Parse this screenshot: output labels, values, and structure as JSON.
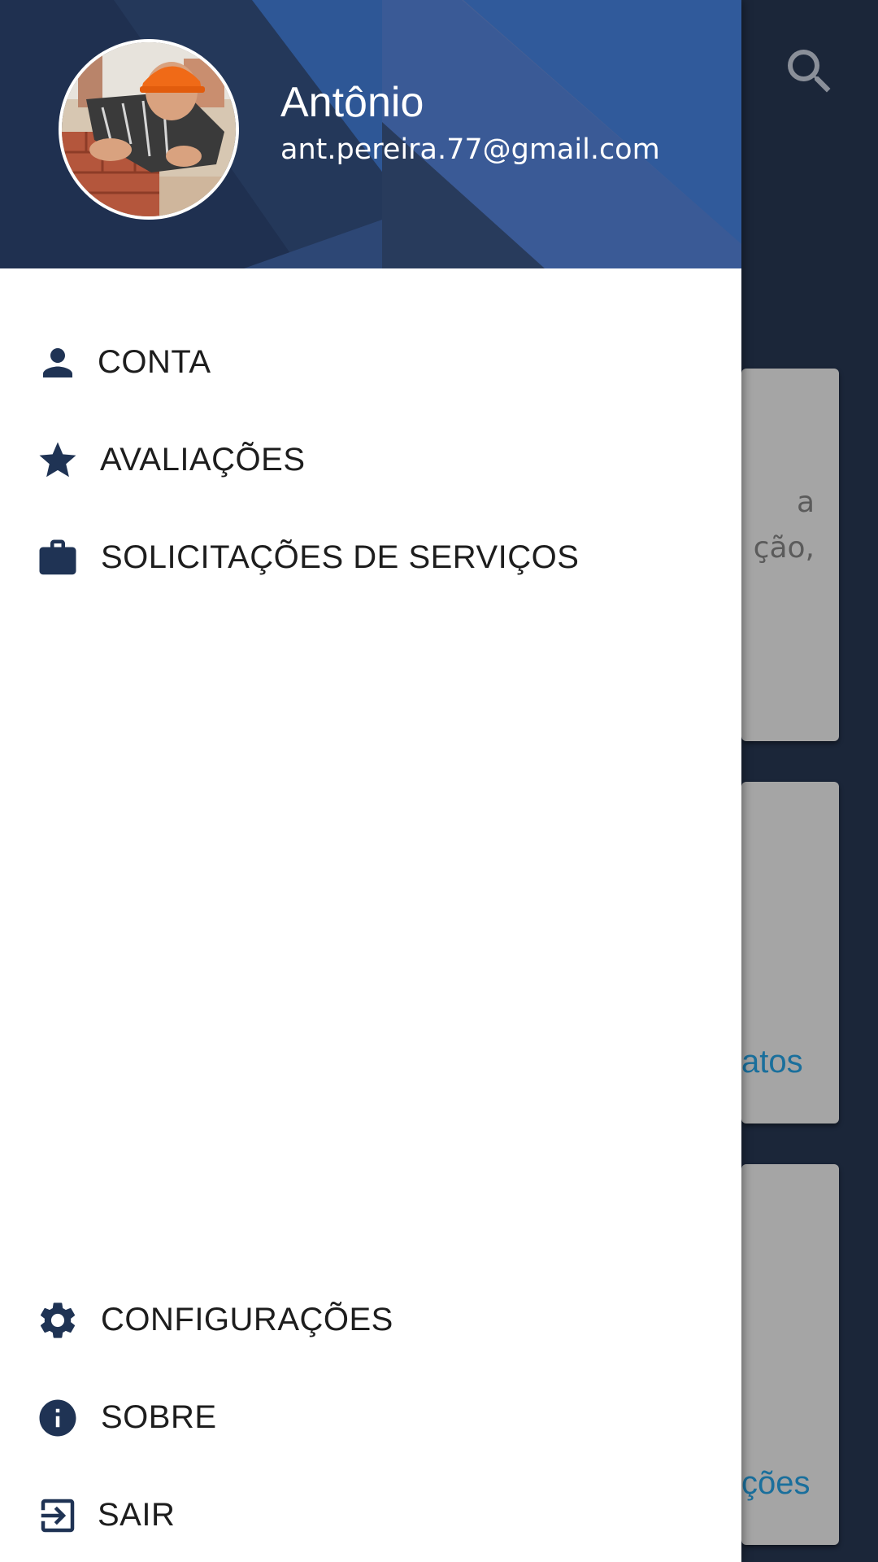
{
  "background": {
    "search_icon": "search-icon",
    "cards": [
      {
        "lines": [
          "a",
          "ção,"
        ]
      },
      {
        "link": "atos"
      },
      {
        "link": "ções"
      }
    ]
  },
  "drawer": {
    "header": {
      "name": "Antônio",
      "email": "ant.pereira.77@gmail.com"
    },
    "menu": [
      {
        "label": "CONTA",
        "icon": "person-icon"
      },
      {
        "label": "AVALIAÇÕES",
        "icon": "star-icon"
      },
      {
        "label": "SOLICITAÇÕES DE SERVIÇOS",
        "icon": "briefcase-icon"
      }
    ],
    "footer_menu": [
      {
        "label": "CONFIGURAÇÕES",
        "icon": "gear-icon"
      },
      {
        "label": "SOBRE",
        "icon": "info-icon"
      },
      {
        "label": "SAIR",
        "icon": "exit-icon"
      }
    ]
  },
  "colors": {
    "header_blue": "#2e5796",
    "icon_navy": "#1f3354",
    "link_blue": "#1a6f9c"
  }
}
